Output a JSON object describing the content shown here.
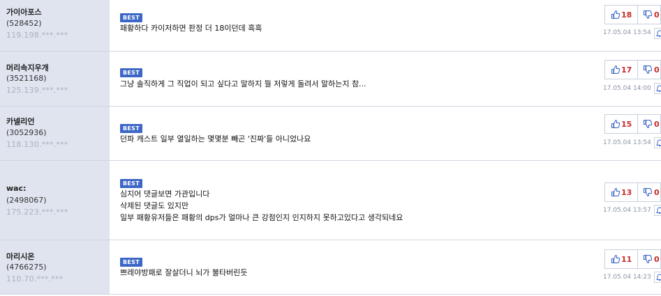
{
  "best_label": "BEST",
  "comments": [
    {
      "nick": "가이아포스",
      "uid": "(528452)",
      "ip": "119.198.***.***",
      "lines": [
        "패황하다 카이저하면 판정 더 18이던데 흑흑"
      ],
      "likes": "18",
      "dislikes": "0",
      "time": "17.05.04 13:54"
    },
    {
      "nick": "머리속지우개",
      "uid": "(3521168)",
      "ip": "125.139.***.***",
      "lines": [
        "그냥 솔직하게 그 직업이 되고 싶다고 말하지 뭘 저렇게 돌려서 말하는지 참..."
      ],
      "likes": "17",
      "dislikes": "0",
      "time": "17.05.04 14:00"
    },
    {
      "nick": "카넬리언",
      "uid": "(3052936)",
      "ip": "118.130.***.***",
      "lines": [
        "던파 캐스트 일부 열일하는 몇몇분 빼곤 '진짜'들 아니었나요"
      ],
      "likes": "15",
      "dislikes": "0",
      "time": "17.05.04 13:54"
    },
    {
      "nick": "wac:",
      "uid": "(2498067)",
      "ip": "175.223.***.***",
      "lines": [
        "심지어 댓글보면 가관입니다",
        "삭제된 댓글도 있지만",
        "일부 패황유저들은 패황의 dps가 얼마나 큰 강점인지 인지하지 못하고있다고 생각되네요"
      ],
      "likes": "13",
      "dislikes": "0",
      "time": "17.05.04 13:57"
    },
    {
      "nick": "마리시온",
      "uid": "(4766275)",
      "ip": "110.70.***.***",
      "lines": [
        "쁘레야방패로 잘살더니 뇌가 불타버린듯"
      ],
      "likes": "11",
      "dislikes": "0",
      "time": "17.05.04 14:23"
    }
  ]
}
